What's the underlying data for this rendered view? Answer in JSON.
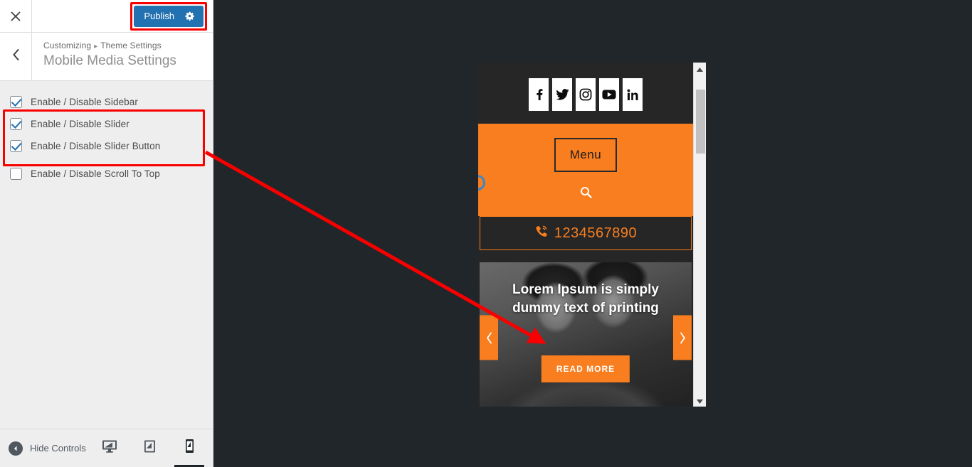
{
  "panel": {
    "close_icon": "close-icon",
    "publish": {
      "label": "Publish",
      "gear_icon": "gear-icon",
      "color": "#2271b1",
      "highlight_color": "#f90000"
    },
    "back_icon": "chevron-left-icon",
    "breadcrumb": {
      "root": "Customizing",
      "separator": "▸",
      "parent": "Theme Settings"
    },
    "section_title": "Mobile Media Settings",
    "controls": [
      {
        "label": "Enable / Disable Sidebar",
        "checked": true
      },
      {
        "label": "Enable / Disable Slider",
        "checked": true
      },
      {
        "label": "Enable / Disable Slider Button",
        "checked": true
      },
      {
        "label": "Enable / Disable Scroll To Top",
        "checked": false
      }
    ],
    "footer": {
      "hide_controls_label": "Hide Controls",
      "devices": [
        {
          "name": "desktop",
          "icon": "desktop-icon",
          "active": false
        },
        {
          "name": "tablet",
          "icon": "tablet-icon",
          "active": false
        },
        {
          "name": "mobile",
          "icon": "mobile-icon",
          "active": true
        }
      ]
    }
  },
  "preview": {
    "social_links": [
      {
        "name": "facebook",
        "icon": "facebook-icon",
        "glyph": "f"
      },
      {
        "name": "twitter",
        "icon": "twitter-icon",
        "glyph": "t"
      },
      {
        "name": "instagram",
        "icon": "instagram-icon",
        "glyph": "ig"
      },
      {
        "name": "youtube",
        "icon": "youtube-icon",
        "glyph": "yt"
      },
      {
        "name": "linkedin",
        "icon": "linkedin-icon",
        "glyph": "in"
      }
    ],
    "menu_label": "Menu",
    "search_icon": "search-icon",
    "phone": {
      "icon": "phone-icon",
      "number": "1234567890"
    },
    "slider": {
      "caption": "Lorem Ipsum is simply dummy text of printing",
      "button_label": "READ MORE",
      "prev_icon": "chevron-left-icon",
      "next_icon": "chevron-right-icon"
    },
    "scrollbar": {
      "up_icon": "caret-up-icon",
      "down_icon": "caret-down-icon"
    },
    "accent_color": "#f97e1f",
    "dark_color": "#262626"
  },
  "annotation": {
    "arrow_color": "#f90000"
  }
}
